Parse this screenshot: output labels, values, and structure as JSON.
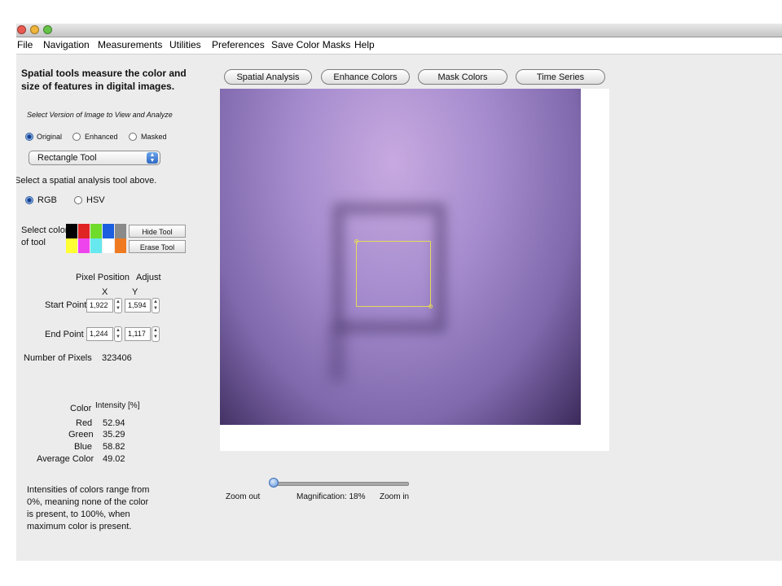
{
  "menu": [
    "File",
    "Navigation",
    "Measurements",
    "Utilities",
    "Preferences",
    "Save Color Masks",
    "Help"
  ],
  "sidebar": {
    "headline_line1": "Spatial tools measure the color and",
    "headline_line2": "size of features in digital images.",
    "version_prompt": "Select Version of Image to View and Analyze",
    "versions": [
      {
        "label": "Original",
        "selected": true
      },
      {
        "label": "Enhanced",
        "selected": false
      },
      {
        "label": "Masked",
        "selected": false
      }
    ],
    "tool_select": {
      "value": "Rectangle Tool"
    },
    "tool_prompt": "Select a spatial analysis tool above.",
    "color_modes": [
      {
        "label": "RGB",
        "selected": true
      },
      {
        "label": "HSV",
        "selected": false
      }
    ],
    "select_color_line1": "Select color",
    "select_color_line2": "of tool",
    "swatches": [
      "#000000",
      "#e02424",
      "#6fdc2c",
      "#1b5fe0",
      "#8a8a8a",
      "#ffff33",
      "#ee44ee",
      "#66e8ee",
      "#ffffff",
      "#f07a20"
    ],
    "hide_tool": "Hide Tool",
    "erase_tool": "Erase Tool",
    "pixel_position_label": "Pixel Position",
    "adjust_label": "Adjust",
    "x_label": "X",
    "y_label": "Y",
    "start_point_label": "Start Point",
    "start_x": "1,922",
    "start_y": "1,594",
    "end_point_label": "End Point",
    "end_x": "1,244",
    "end_y": "1,117",
    "num_pixels_label": "Number of Pixels",
    "num_pixels_value": "323406",
    "color_header": "Color",
    "intensity_header": "Intensity [%]",
    "intensities": [
      {
        "label": "Red",
        "value": "52.94"
      },
      {
        "label": "Green",
        "value": "35.29"
      },
      {
        "label": "Blue",
        "value": "58.82"
      },
      {
        "label": "Average Color",
        "value": "49.02"
      }
    ],
    "note_lines": [
      "Intensities of colors range from",
      "0%, meaning none of the color",
      "is present, to 100%, when",
      "maximum color is present."
    ]
  },
  "tabs": [
    "Spatial Analysis",
    "Enhance Colors",
    "Mask Colors",
    "Time Series"
  ],
  "selection_color": "#e6d85a",
  "zoom": {
    "out_label": "Zoom out",
    "magnification_label": "Magnification: 18%",
    "in_label": "Zoom in",
    "magnification_value": 18
  }
}
